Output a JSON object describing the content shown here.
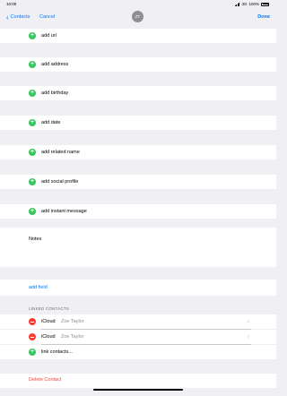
{
  "status": {
    "time": "10:00",
    "network": "3G",
    "battery": "100%"
  },
  "nav": {
    "back_label": "Contacts",
    "cancel_label": "Cancel",
    "avatar_initials": "ZT",
    "done_label": "Done"
  },
  "add_rows": [
    "add url",
    "add address",
    "add birthday",
    "add date",
    "add related name",
    "add social profile",
    "add instant message"
  ],
  "notes_label": "Notes",
  "add_field_label": "add field",
  "linked": {
    "header": "LINKED CONTACTS",
    "items": [
      {
        "source": "iCloud",
        "name": "Zoe Taylor"
      },
      {
        "source": "iCloud",
        "name": "Zoe Taylor"
      }
    ],
    "link_label": "link contacts..."
  },
  "delete_label": "Delete Contact",
  "colors": {
    "accent": "#007aff",
    "add": "#34c759",
    "delete": "#ff3b30",
    "background": "#efeff4"
  }
}
